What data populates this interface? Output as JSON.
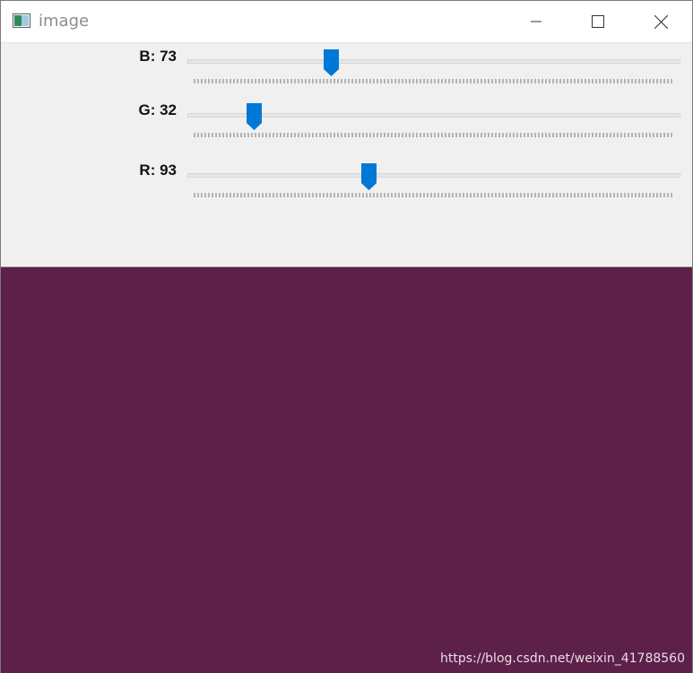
{
  "window": {
    "title": "image",
    "icon": "image-window-icon",
    "buttons": {
      "minimize": "minimize-icon",
      "maximize": "maximize-icon",
      "close": "close-icon"
    }
  },
  "trackbars": [
    {
      "channel": "B",
      "label": "B: 73",
      "value": 73,
      "max": 255
    },
    {
      "channel": "G",
      "label": "G: 32",
      "value": 32,
      "max": 255
    },
    {
      "channel": "R",
      "label": "R: 93",
      "value": 93,
      "max": 255
    }
  ],
  "canvas": {
    "color": "#5d2049"
  },
  "colors": {
    "thumb": "#0078d7",
    "controls_bg": "#f0f0f0"
  },
  "watermark": "https://blog.csdn.net/weixin_41788560"
}
